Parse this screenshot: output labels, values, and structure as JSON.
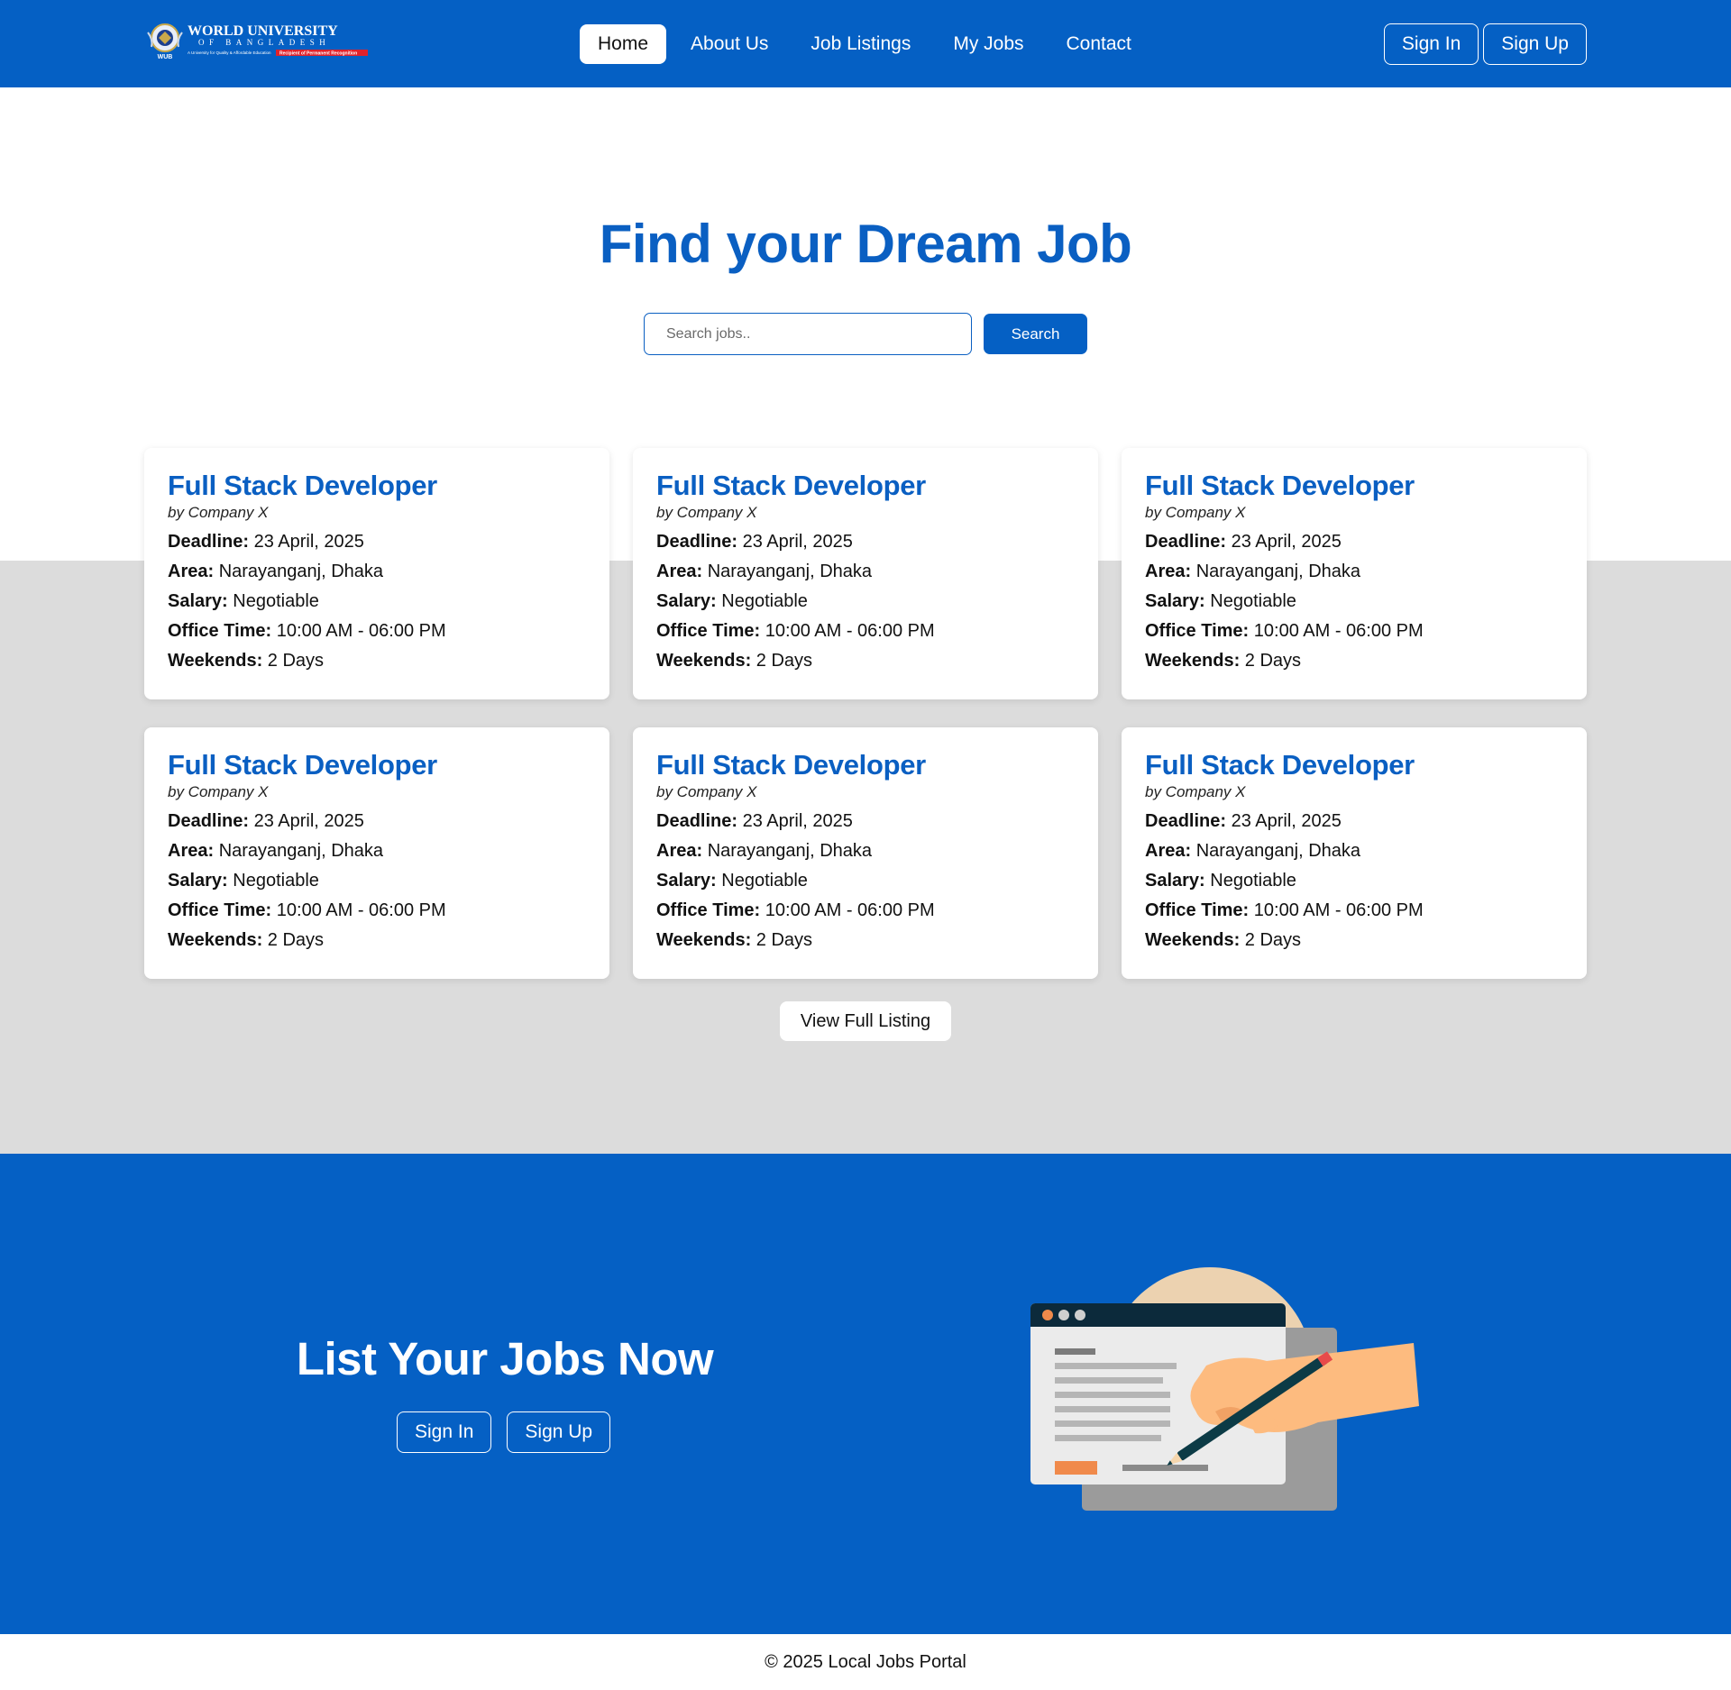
{
  "brand": {
    "name_line1": "WORLD UNIVERSITY",
    "name_line2": "OF BANGLADESH",
    "tagline": "A University for Quality & Affordable Education",
    "badge": "Recipient of Permanent Recognition",
    "seal_text": "WUB"
  },
  "nav": {
    "links": [
      "Home",
      "About Us",
      "Job Listings",
      "My Jobs",
      "Contact"
    ],
    "active": "Home",
    "sign_in": "Sign In",
    "sign_up": "Sign Up"
  },
  "hero": {
    "title": "Find your Dream Job",
    "search_placeholder": "Search jobs..",
    "search_button": "Search"
  },
  "jobs": [
    {
      "title": "Full Stack Developer",
      "company": "by Company X",
      "deadline": "23 April, 2025",
      "area": "Narayanganj, Dhaka",
      "salary": "Negotiable",
      "office_time": "10:00 AM - 06:00 PM",
      "weekends": "2 Days"
    },
    {
      "title": "Full Stack Developer",
      "company": "by Company X",
      "deadline": "23 April, 2025",
      "area": "Narayanganj, Dhaka",
      "salary": "Negotiable",
      "office_time": "10:00 AM - 06:00 PM",
      "weekends": "2 Days"
    },
    {
      "title": "Full Stack Developer",
      "company": "by Company X",
      "deadline": "23 April, 2025",
      "area": "Narayanganj, Dhaka",
      "salary": "Negotiable",
      "office_time": "10:00 AM - 06:00 PM",
      "weekends": "2 Days"
    },
    {
      "title": "Full Stack Developer",
      "company": "by Company X",
      "deadline": "23 April, 2025",
      "area": "Narayanganj, Dhaka",
      "salary": "Negotiable",
      "office_time": "10:00 AM - 06:00 PM",
      "weekends": "2 Days"
    },
    {
      "title": "Full Stack Developer",
      "company": "by Company X",
      "deadline": "23 April, 2025",
      "area": "Narayanganj, Dhaka",
      "salary": "Negotiable",
      "office_time": "10:00 AM - 06:00 PM",
      "weekends": "2 Days"
    },
    {
      "title": "Full Stack Developer",
      "company": "by Company X",
      "deadline": "23 April, 2025",
      "area": "Narayanganj, Dhaka",
      "salary": "Negotiable",
      "office_time": "10:00 AM - 06:00 PM",
      "weekends": "2 Days"
    }
  ],
  "field_labels": {
    "deadline": "Deadline:",
    "area": "Area:",
    "salary": "Salary:",
    "office_time": "Office Time:",
    "weekends": "Weekends:"
  },
  "view_full_listing": "View Full Listing",
  "cta": {
    "title": "List Your Jobs Now",
    "sign_in": "Sign In",
    "sign_up": "Sign Up",
    "illustration": "hand-writing-on-document-illustration"
  },
  "footer": {
    "text": "© 2025 Local Jobs Portal"
  },
  "colors": {
    "primary": "#0560c4",
    "heading_blue": "#0a5fc2",
    "band_gray": "#dcdcdc"
  }
}
